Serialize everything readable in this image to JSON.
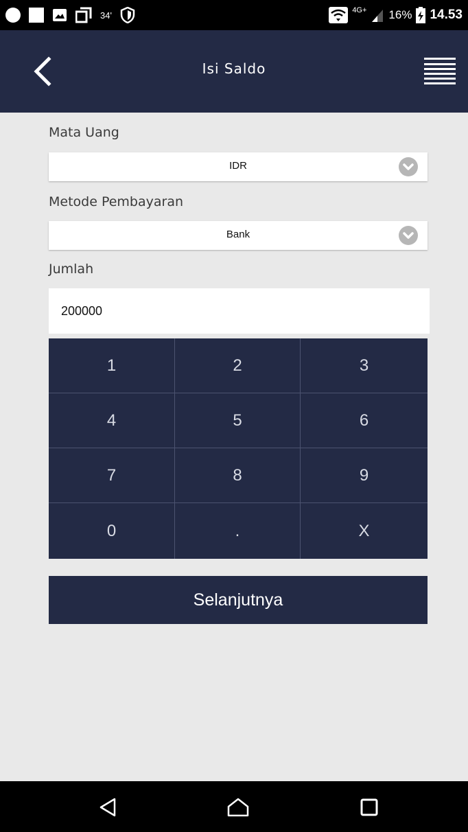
{
  "status_bar": {
    "temperature": "34'",
    "network": "4G+",
    "battery_percent": "16%",
    "time": "14.53",
    "icons": [
      "circle-icon",
      "square-icon",
      "image-icon",
      "window-icon",
      "shield-icon",
      "wifi-icon",
      "signal-icon",
      "battery-charging-icon"
    ]
  },
  "header": {
    "title": "Isi Saldo",
    "back_icon": "chevron-left-icon",
    "menu_icon": "menu-icon"
  },
  "form": {
    "currency_label": "Mata Uang",
    "currency_value": "IDR",
    "payment_method_label": "Metode Pembayaran",
    "payment_method_value": "Bank",
    "amount_label": "Jumlah",
    "amount_value": "200000"
  },
  "keypad": {
    "keys": [
      "1",
      "2",
      "3",
      "4",
      "5",
      "6",
      "7",
      "8",
      "9",
      "0",
      ".",
      "X"
    ]
  },
  "next_button": "Selanjutnya",
  "colors": {
    "primary": "#232a45",
    "background": "#e9e9e9",
    "dropdown_icon": "#b6b6b6"
  }
}
